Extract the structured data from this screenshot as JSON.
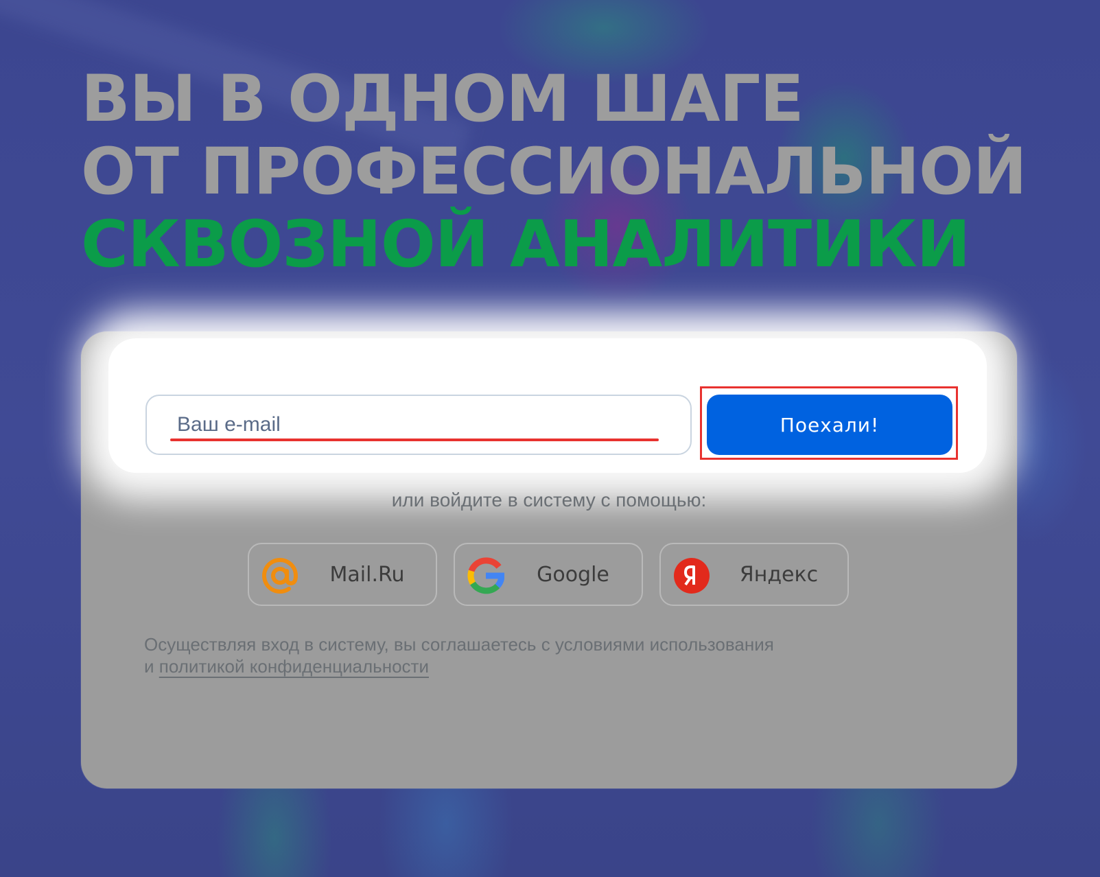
{
  "headline": {
    "line1": "ВЫ В ОДНОМ ШАГЕ",
    "line2": "ОТ ПРОФЕССИОНАЛЬНОЙ",
    "line3": "СКВОЗНОЙ АНАЛИТИКИ"
  },
  "form": {
    "email_placeholder": "Ваш e-mail",
    "email_value": "",
    "submit_label": "Поехали!",
    "alt_login_text": "или войдите в систему с помощью:"
  },
  "social": {
    "mailru": {
      "label": "Mail.Ru",
      "icon": "at-sign-icon"
    },
    "google": {
      "label": "Google",
      "icon": "google-g-icon"
    },
    "yandex": {
      "label": "Яндекс",
      "icon": "yandex-ya-icon"
    }
  },
  "terms": {
    "line1": "Осуществляя вход в систему, вы соглашаетесь с условиями использования",
    "prefix": "и",
    "link": "политикой конфиденциальности"
  },
  "colors": {
    "accent_blue": "#0062e0",
    "headline_green": "#0b9c49",
    "headline_gray": "#9d9d9d",
    "highlight_red": "#e8322f",
    "mailru_orange": "#f08d0f",
    "yandex_red": "#e22a1c"
  }
}
